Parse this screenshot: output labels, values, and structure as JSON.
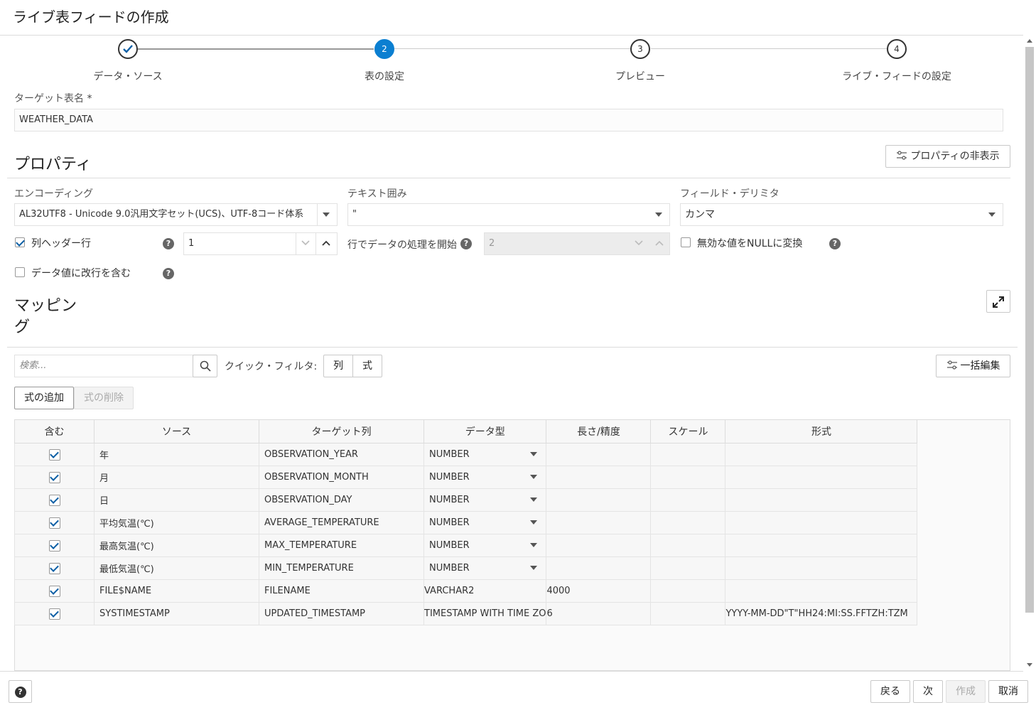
{
  "window": {
    "title": "ライブ表フィードの作成"
  },
  "steps": [
    {
      "number": "1",
      "label": "データ・ソース",
      "state": "done"
    },
    {
      "number": "2",
      "label": "表の設定",
      "state": "active"
    },
    {
      "number": "3",
      "label": "プレビュー",
      "state": "pending"
    },
    {
      "number": "4",
      "label": "ライブ・フィードの設定",
      "state": "pending"
    }
  ],
  "target_table": {
    "label": "ターゲット表名",
    "required_mark": "*",
    "value": "WEATHER_DATA"
  },
  "properties": {
    "title": "プロパティ",
    "hide_button": "プロパティの非表示",
    "encoding": {
      "label": "エンコーディング",
      "value": "AL32UTF8 - Unicode 9.0汎用文字セット(UCS)、UTF-8コード体系"
    },
    "text_enclosure": {
      "label": "テキスト囲み",
      "value": "\""
    },
    "field_delimiter": {
      "label": "フィールド・デリミタ",
      "value": "カンマ"
    },
    "column_header_row": {
      "label": "列ヘッダー行",
      "checked": true,
      "value": "1"
    },
    "start_row": {
      "label": "行でデータの処理を開始",
      "value": "2"
    },
    "invalid_to_null": {
      "label": "無効な値をNULLに変換",
      "checked": false
    },
    "newline_in_values": {
      "label": "データ値に改行を含む",
      "checked": false
    },
    "help_glyph": "?"
  },
  "mapping": {
    "title_line1": "マッピン",
    "title_line2": "グ",
    "search_placeholder": "検索...",
    "quick_filter_label": "クイック・フィルタ:",
    "filter_column": "列",
    "filter_expression": "式",
    "bulk_edit": "一括編集",
    "add_expression": "式の追加",
    "delete_expression": "式の削除",
    "columns": [
      "含む",
      "ソース",
      "ターゲット列",
      "データ型",
      "長さ/精度",
      "スケール",
      "形式"
    ],
    "rows": [
      {
        "source": "年",
        "target": "OBSERVATION_YEAR",
        "type": "NUMBER",
        "editable": true,
        "length": "",
        "scale": "",
        "format": ""
      },
      {
        "source": "月",
        "target": "OBSERVATION_MONTH",
        "type": "NUMBER",
        "editable": true,
        "length": "",
        "scale": "",
        "format": ""
      },
      {
        "source": "日",
        "target": "OBSERVATION_DAY",
        "type": "NUMBER",
        "editable": true,
        "length": "",
        "scale": "",
        "format": ""
      },
      {
        "source": "平均気温(℃)",
        "target": "AVERAGE_TEMPERATURE",
        "type": "NUMBER",
        "editable": true,
        "length": "",
        "scale": "",
        "format": ""
      },
      {
        "source": "最高気温(℃)",
        "target": "MAX_TEMPERATURE",
        "type": "NUMBER",
        "editable": true,
        "length": "",
        "scale": "",
        "format": ""
      },
      {
        "source": "最低気温(℃)",
        "target": "MIN_TEMPERATURE",
        "type": "NUMBER",
        "editable": true,
        "length": "",
        "scale": "",
        "format": ""
      },
      {
        "source": "FILE$NAME",
        "target": "FILENAME",
        "type": "VARCHAR2",
        "editable": false,
        "length": "4000",
        "scale": "",
        "format": ""
      },
      {
        "source": "SYSTIMESTAMP",
        "target": "UPDATED_TIMESTAMP",
        "type": "TIMESTAMP WITH TIME ZO",
        "editable": false,
        "length": "6",
        "scale": "",
        "format": "YYYY-MM-DD\"T\"HH24:MI:SS.FFTZH:TZM"
      }
    ]
  },
  "footer": {
    "help_glyph": "?",
    "back": "戻る",
    "next": "次",
    "create": "作成",
    "cancel": "取消"
  }
}
